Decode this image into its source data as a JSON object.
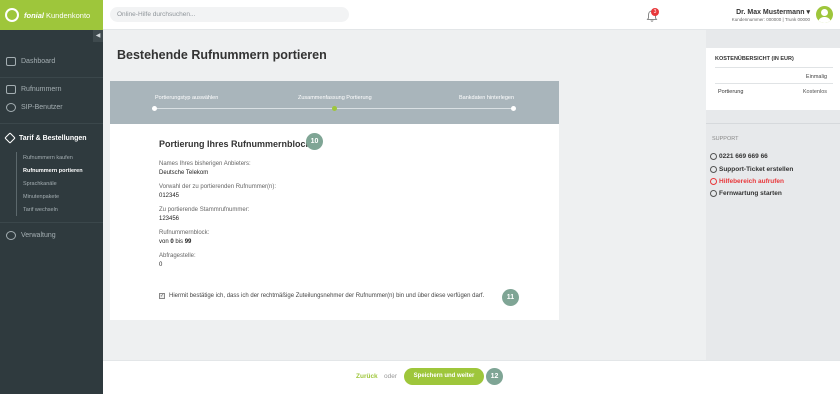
{
  "brand": {
    "name": "fonial",
    "subtitle": "Kundenkonto"
  },
  "search": {
    "placeholder": "Online-Hilfe durchsuchen..."
  },
  "notifications": {
    "count": "3"
  },
  "user": {
    "name": "Dr. Max Mustermann ▾",
    "details": "Kundennummer: 000000 | Trunk 00000"
  },
  "sidebar": {
    "items": [
      {
        "label": "Dashboard"
      },
      {
        "label": "Rufnummern"
      },
      {
        "label": "SIP-Benutzer"
      },
      {
        "label": "Tarif & Bestellungen"
      },
      {
        "label": "Verwaltung"
      }
    ],
    "subitems": [
      {
        "label": "Rufnummern kaufen"
      },
      {
        "label": "Rufnummern portieren"
      },
      {
        "label": "Sprachkanäle"
      },
      {
        "label": "Minutenpakete"
      },
      {
        "label": "Tarif wechseln"
      }
    ]
  },
  "page": {
    "title": "Bestehende Rufnummern portieren"
  },
  "steps": [
    {
      "label": "Portierungstyp auswählen"
    },
    {
      "label": "Zusammenfassung Portierung"
    },
    {
      "label": "Bankdaten hinterlegen"
    }
  ],
  "summary": {
    "title": "Portierung Ihres Rufnummernblocks",
    "badge": "10",
    "fields": [
      {
        "label": "Names Ihres bisherigen Anbieters:",
        "value": "Deutsche Telekom"
      },
      {
        "label": "Vorwahl der zu portierenden Rufnummer(n):",
        "value": "012345"
      },
      {
        "label": "Zu portierende Stammrufnummer:",
        "value": "123456"
      },
      {
        "label": "Rufnummernblock:",
        "value_prefix": "von ",
        "value_from": "0",
        "value_mid": " bis ",
        "value_to": "99"
      },
      {
        "label": "Abfragestelle:",
        "value": "0"
      }
    ],
    "confirm_text": "Hiermit bestätige ich, dass ich der rechtmäßige Zuteilungsnehmer der Rufnummer(n) bin und über diese verfügen darf.",
    "confirm_badge": "11"
  },
  "costs": {
    "title": "KOSTENÜBERSICHT (IN EUR)",
    "column": "Einmalig",
    "row_label": "Portierung",
    "row_value": "Kostenlos"
  },
  "support": {
    "title": "SUPPORT",
    "phone": "0221 669 669 66",
    "ticket": "Support-Ticket erstellen",
    "help": "Hilfebereich aufrufen",
    "remote": "Fernwartung starten"
  },
  "footer": {
    "back": "Zurück",
    "or": "oder",
    "save": "Speichern und weiter",
    "badge": "12"
  },
  "colors": {
    "accent": "#9ec63b",
    "sidebar": "#2f3a3e",
    "badge": "#7fa595",
    "alert": "#e8383b"
  }
}
